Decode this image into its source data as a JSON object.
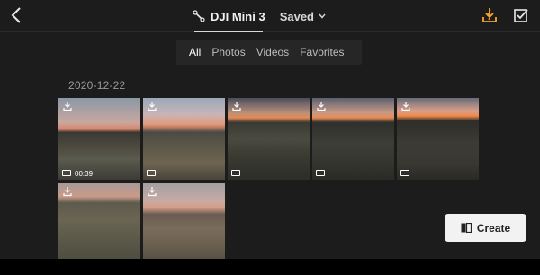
{
  "header": {
    "device_name": "DJI Mini 3",
    "dropdown_label": "Saved",
    "icons": {
      "back": "chevron-left-icon",
      "device": "drone-icon",
      "download": "download-icon",
      "select": "checkbox-icon"
    },
    "accent_color": "#f5a623"
  },
  "filters": {
    "items": [
      {
        "label": "All",
        "active": true
      },
      {
        "label": "Photos",
        "active": false
      },
      {
        "label": "Videos",
        "active": false
      },
      {
        "label": "Favorites",
        "active": false
      }
    ]
  },
  "gallery": {
    "date": "2020-12-22",
    "items": [
      {
        "type": "video",
        "duration": "00:39"
      },
      {
        "type": "video",
        "duration": ""
      },
      {
        "type": "video",
        "duration": ""
      },
      {
        "type": "video",
        "duration": ""
      },
      {
        "type": "video",
        "duration": ""
      },
      {
        "type": "video",
        "duration": ""
      },
      {
        "type": "video",
        "duration": ""
      }
    ]
  },
  "actions": {
    "create_label": "Create"
  }
}
